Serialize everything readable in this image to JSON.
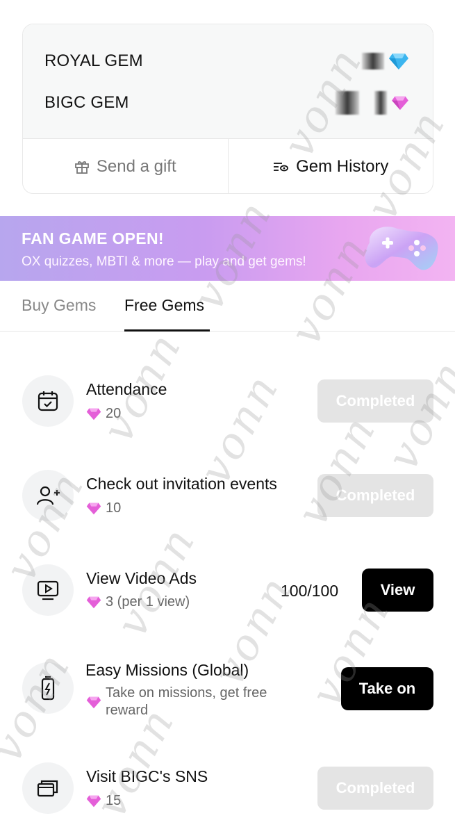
{
  "balances": [
    {
      "label": "ROYAL GEM",
      "gem": "blue-diamond-icon",
      "color": "#3bb5ef"
    },
    {
      "label": "BIGC GEM",
      "gem": "pink-diamond-icon",
      "color": "#e45fd8"
    }
  ],
  "actions": {
    "send_gift": "Send a gift",
    "gem_history": "Gem History"
  },
  "banner": {
    "title": "FAN GAME OPEN!",
    "subtitle": "OX quizzes, MBTI & more — play and get gems!"
  },
  "tabs": {
    "buy": "Buy Gems",
    "free": "Free Gems",
    "active": "Free Gems"
  },
  "missions": [
    {
      "title": "Attendance",
      "reward": "20",
      "icon": "calendar-check-icon",
      "button": "Completed",
      "state": "completed"
    },
    {
      "title": "Check out invitation events",
      "reward": "10",
      "icon": "add-user-icon",
      "button": "Completed",
      "state": "completed"
    },
    {
      "title": "View Video Ads",
      "reward": "3 (per 1 view)",
      "icon": "video-play-icon",
      "count": "100/100",
      "button": "View",
      "state": "active"
    },
    {
      "title": "Easy Missions (Global)",
      "reward": "Take on missions, get free reward",
      "icon": "battery-charge-icon",
      "button": "Take on",
      "state": "active"
    },
    {
      "title": "Visit BIGC's SNS",
      "reward": "15",
      "icon": "window-stack-icon",
      "button": "Completed",
      "state": "completed"
    }
  ],
  "watermark": "vonn",
  "colors": {
    "pink_gem": "#e45fd8",
    "blue_gem": "#3bb5ef",
    "completed_bg": "#e4e4e4",
    "banner_start": "#b7a6ee",
    "banner_end": "#f3b4f2"
  }
}
